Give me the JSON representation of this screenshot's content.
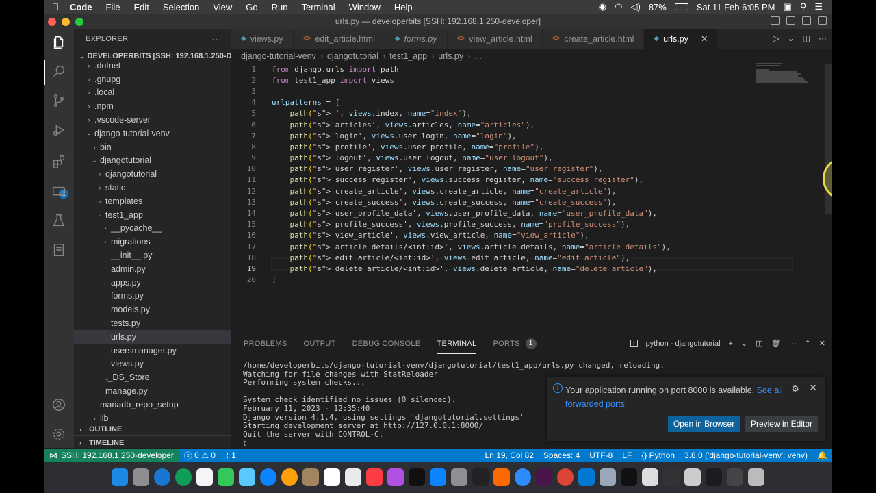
{
  "menubar": {
    "app": "Code",
    "items": [
      "File",
      "Edit",
      "Selection",
      "View",
      "Go",
      "Run",
      "Terminal",
      "Window",
      "Help"
    ],
    "battery": "87%",
    "clock": "Sat 11 Feb  6:05 PM"
  },
  "window": {
    "title": "urls.py — developerbits [SSH: 192.168.1.250-developer]"
  },
  "sidebar": {
    "header": "EXPLORER",
    "root": "DEVELOPERBITS [SSH: 192.168.1.250-D...",
    "tree": [
      {
        "label": ".dotnet",
        "indent": 1,
        "chev": "›"
      },
      {
        "label": ".gnupg",
        "indent": 1,
        "chev": "›"
      },
      {
        "label": ".local",
        "indent": 1,
        "chev": "›"
      },
      {
        "label": ".npm",
        "indent": 1,
        "chev": "›"
      },
      {
        "label": ".vscode-server",
        "indent": 1,
        "chev": "›"
      },
      {
        "label": "django-tutorial-venv",
        "indent": 1,
        "chev": "⌄"
      },
      {
        "label": "bin",
        "indent": 2,
        "chev": "›"
      },
      {
        "label": "djangotutorial",
        "indent": 2,
        "chev": "⌄"
      },
      {
        "label": "djangotutorial",
        "indent": 3,
        "chev": "›"
      },
      {
        "label": "static",
        "indent": 3,
        "chev": "›"
      },
      {
        "label": "templates",
        "indent": 3,
        "chev": "›"
      },
      {
        "label": "test1_app",
        "indent": 3,
        "chev": "⌄"
      },
      {
        "label": "__pycache__",
        "indent": 4,
        "chev": "›"
      },
      {
        "label": "migrations",
        "indent": 4,
        "chev": "›"
      },
      {
        "label": "__init__.py",
        "indent": 4,
        "chev": ""
      },
      {
        "label": "admin.py",
        "indent": 4,
        "chev": ""
      },
      {
        "label": "apps.py",
        "indent": 4,
        "chev": ""
      },
      {
        "label": "forms.py",
        "indent": 4,
        "chev": ""
      },
      {
        "label": "models.py",
        "indent": 4,
        "chev": ""
      },
      {
        "label": "tests.py",
        "indent": 4,
        "chev": ""
      },
      {
        "label": "urls.py",
        "indent": 4,
        "chev": "",
        "selected": true
      },
      {
        "label": "usersmanager.py",
        "indent": 4,
        "chev": ""
      },
      {
        "label": "views.py",
        "indent": 4,
        "chev": ""
      },
      {
        "label": "._DS_Store",
        "indent": 3,
        "chev": ""
      },
      {
        "label": "manage.py",
        "indent": 3,
        "chev": ""
      },
      {
        "label": "mariadb_repo_setup",
        "indent": 2,
        "chev": ""
      },
      {
        "label": "lib",
        "indent": 2,
        "chev": "›"
      }
    ],
    "outline": "OUTLINE",
    "timeline": "TIMELINE"
  },
  "tabs": [
    {
      "label": "views.py",
      "icon": "python-icon",
      "color": "#519aba"
    },
    {
      "label": "edit_article.html",
      "icon": "html-icon",
      "color": "#e37933"
    },
    {
      "label": "forms.py",
      "icon": "python-icon",
      "color": "#519aba",
      "italic": true
    },
    {
      "label": "view_article.html",
      "icon": "html-icon",
      "color": "#e37933"
    },
    {
      "label": "create_article.html",
      "icon": "html-icon",
      "color": "#e37933"
    },
    {
      "label": "urls.py",
      "icon": "python-icon",
      "color": "#519aba",
      "active": true
    }
  ],
  "breadcrumb": [
    "django-tutorial-venv",
    "djangotutorial",
    "test1_app",
    "urls.py",
    "..."
  ],
  "code": {
    "current_line": 19,
    "lines": [
      "from django.urls import path",
      "from test1_app import views",
      "",
      "urlpatterns = [",
      "    path('', views.index, name=\"index\"),",
      "    path('articles', views.articles, name=\"articles\"),",
      "    path('login', views.user_login, name=\"login\"),",
      "    path('profile', views.user_profile, name=\"profile\"),",
      "    path('logout', views.user_logout, name=\"user_logout\"),",
      "    path('user_register', views.user_register, name=\"user_register\"),",
      "    path('success_register', views.success_register, name=\"success_register\"),",
      "    path('create_article', views.create_article, name=\"create_article\"),",
      "    path('create_success', views.create_success, name=\"create_success\"),",
      "    path('user_profile_data', views.user_profile_data, name=\"user_profile_data\"),",
      "    path('profile_success', views.profile_success, name=\"profile_success\"),",
      "    path('view_article', views.view_article, name=\"view_article\"),",
      "    path('article_details/<int:id>', views.article_details, name=\"article_details\"),",
      "    path('edit_article/<int:id>', views.edit_article, name=\"edit_article\"),",
      "    path('delete_article/<int:id>', views.delete_article, name=\"delete_article\"),",
      "]"
    ]
  },
  "panel": {
    "tabs": [
      "PROBLEMS",
      "OUTPUT",
      "DEBUG CONSOLE",
      "TERMINAL",
      "PORTS"
    ],
    "active_tab": "TERMINAL",
    "ports_badge": "1",
    "terminal_name": "python - djangotutorial",
    "terminal_lines": [
      "/home/developerbits/django-tutorial-venv/djangotutorial/test1_app/urls.py changed, reloading.",
      "Watching for file changes with StatReloader",
      "Performing system checks...",
      "",
      "System check identified no issues (0 silenced).",
      "February 11, 2023 - 12:35:40",
      "Django version 4.1.4, using settings 'djangotutorial.settings'",
      "Starting development server at http://127.0.0.1:8000/",
      "Quit the server with CONTROL-C.",
      "▯"
    ]
  },
  "notification": {
    "message": "Your application running on port 8000 is available.",
    "link_text_1": "See all",
    "link_text_2": "forwarded ports",
    "open_browser": "Open in Browser",
    "preview_editor": "Preview in Editor"
  },
  "status": {
    "remote": "SSH: 192.168.1.250-developer",
    "errors": "0",
    "warnings": "0",
    "ports": "1",
    "position": "Ln 19, Col 82",
    "spaces": "Spaces: 4",
    "encoding": "UTF-8",
    "eol": "LF",
    "language": "Python",
    "interpreter": "3.8.0 ('django-tutorial-venv': venv)"
  },
  "colors": {
    "accent": "#007acc",
    "remote": "#16825d",
    "button": "#0e639c"
  }
}
